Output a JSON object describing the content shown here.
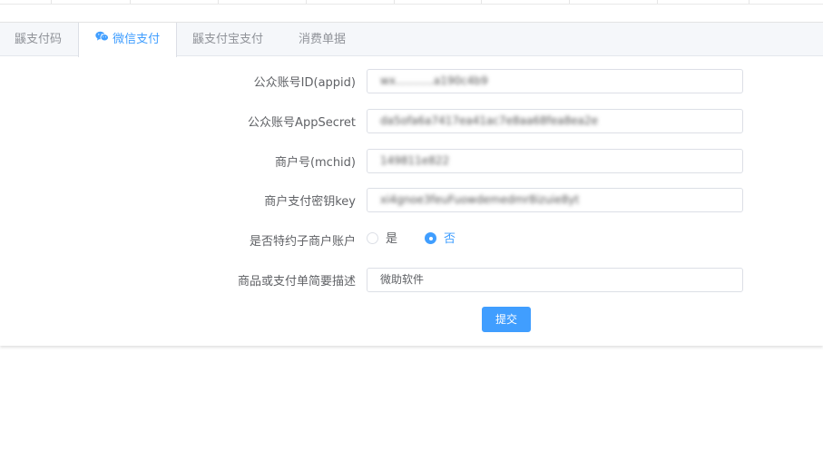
{
  "tabs": [
    {
      "label": "鼷支付码"
    },
    {
      "label": "微信支付"
    },
    {
      "label": "鼷支付宝支付"
    },
    {
      "label": "消费单据"
    }
  ],
  "form": {
    "appid_label": "公众账号ID(appid)",
    "appid_value": "wx...........a190c4b9",
    "appsecret_label": "公众账号AppSecret",
    "appsecret_value": "da5ofa6a7417ea41ac7e8aa68fea8ea2e",
    "mchid_label": "商户号(mchid)",
    "mchid_value": "149811e822",
    "key_label": "商户支付密钥key",
    "key_value": "xi4gnoe3feuFuowdemedmr8izuie8yt",
    "special_label": "是否特约子商户账户",
    "radio_yes": "是",
    "radio_no": "否",
    "desc_label": "商品或支付单简要描述",
    "desc_value": "微助软件",
    "submit": "提交"
  },
  "colors": {
    "accent": "#409eff",
    "wechat_icon": "#409eff"
  },
  "icons": {
    "wechat": "wechat-icon"
  }
}
